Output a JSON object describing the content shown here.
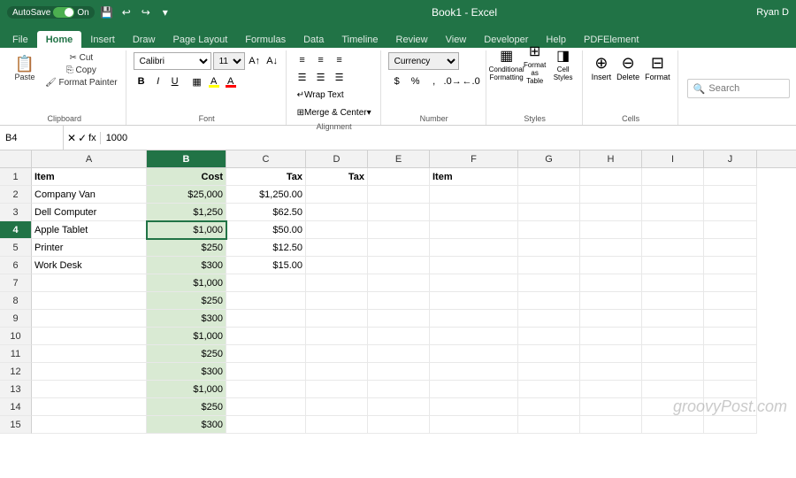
{
  "titleBar": {
    "autoSave": "AutoSave",
    "autoSaveState": "On",
    "fileName": "Book1 - Excel",
    "userName": "Ryan D"
  },
  "ribbonTabs": {
    "tabs": [
      "File",
      "Home",
      "Insert",
      "Draw",
      "Page Layout",
      "Formulas",
      "Data",
      "Timeline",
      "Review",
      "View",
      "Developer",
      "Help",
      "PDFElement"
    ]
  },
  "ribbon": {
    "clipboard": {
      "label": "Clipboard",
      "paste": "Paste"
    },
    "font": {
      "label": "Font",
      "name": "Calibri",
      "size": "11"
    },
    "alignment": {
      "label": "Alignment",
      "wrapText": "Wrap Text",
      "mergeCenter": "Merge & Center"
    },
    "number": {
      "label": "Number",
      "format": "Currency"
    },
    "styles": {
      "label": "Styles",
      "conditional": "Conditional Formatting",
      "formatTable": "Format as Table",
      "cellStyles": "Cell Styles"
    },
    "cells": {
      "label": "Cells",
      "insert": "Insert",
      "delete": "Delete",
      "format": "Format"
    },
    "search": {
      "placeholder": "Search"
    }
  },
  "formulaBar": {
    "cellRef": "B4",
    "formulaValue": "1000"
  },
  "columns": [
    "A",
    "B",
    "C",
    "D",
    "E",
    "F",
    "G",
    "H",
    "I",
    "J"
  ],
  "headers": {
    "row1": {
      "a": "Item",
      "b": "Cost",
      "c": "Tax",
      "d": "Tax",
      "f": "Item"
    }
  },
  "rows": [
    {
      "num": "2",
      "a": "Company Van",
      "b": "$25,000",
      "c": "$1,250.00",
      "d": "",
      "e": "",
      "f": "",
      "g": "",
      "h": "",
      "i": "",
      "j": ""
    },
    {
      "num": "3",
      "a": "Dell Computer",
      "b": "$1,250",
      "c": "$62.50",
      "d": "",
      "e": "",
      "f": "",
      "g": "",
      "h": "",
      "i": "",
      "j": ""
    },
    {
      "num": "4",
      "a": "Apple Tablet",
      "b": "$1,000",
      "c": "$50.00",
      "d": "",
      "e": "",
      "f": "",
      "g": "",
      "h": "",
      "i": "",
      "j": ""
    },
    {
      "num": "5",
      "a": "Printer",
      "b": "$250",
      "c": "$12.50",
      "d": "",
      "e": "",
      "f": "",
      "g": "",
      "h": "",
      "i": "",
      "j": ""
    },
    {
      "num": "6",
      "a": "Work Desk",
      "b": "$300",
      "c": "$15.00",
      "d": "",
      "e": "",
      "f": "",
      "g": "",
      "h": "",
      "i": "",
      "j": ""
    },
    {
      "num": "7",
      "a": "",
      "b": "$1,000",
      "c": "",
      "d": "",
      "e": "",
      "f": "",
      "g": "",
      "h": "",
      "i": "",
      "j": ""
    },
    {
      "num": "8",
      "a": "",
      "b": "$250",
      "c": "",
      "d": "",
      "e": "",
      "f": "",
      "g": "",
      "h": "",
      "i": "",
      "j": ""
    },
    {
      "num": "9",
      "a": "",
      "b": "$300",
      "c": "",
      "d": "",
      "e": "",
      "f": "",
      "g": "",
      "h": "",
      "i": "",
      "j": ""
    },
    {
      "num": "10",
      "a": "",
      "b": "$1,000",
      "c": "",
      "d": "",
      "e": "",
      "f": "",
      "g": "",
      "h": "",
      "i": "",
      "j": ""
    },
    {
      "num": "11",
      "a": "",
      "b": "$250",
      "c": "",
      "d": "",
      "e": "",
      "f": "",
      "g": "",
      "h": "",
      "i": "",
      "j": ""
    },
    {
      "num": "12",
      "a": "",
      "b": "$300",
      "c": "",
      "d": "",
      "e": "",
      "f": "",
      "g": "",
      "h": "",
      "i": "",
      "j": ""
    },
    {
      "num": "13",
      "a": "",
      "b": "$1,000",
      "c": "",
      "d": "",
      "e": "",
      "f": "",
      "g": "",
      "h": "",
      "i": "",
      "j": ""
    },
    {
      "num": "14",
      "a": "",
      "b": "$250",
      "c": "",
      "d": "",
      "e": "",
      "f": "",
      "g": "",
      "h": "",
      "i": "",
      "j": ""
    },
    {
      "num": "15",
      "a": "",
      "b": "$300",
      "c": "",
      "d": "",
      "e": "",
      "f": "",
      "g": "",
      "h": "",
      "i": "",
      "j": ""
    }
  ],
  "watermark": "groovyPost.com"
}
